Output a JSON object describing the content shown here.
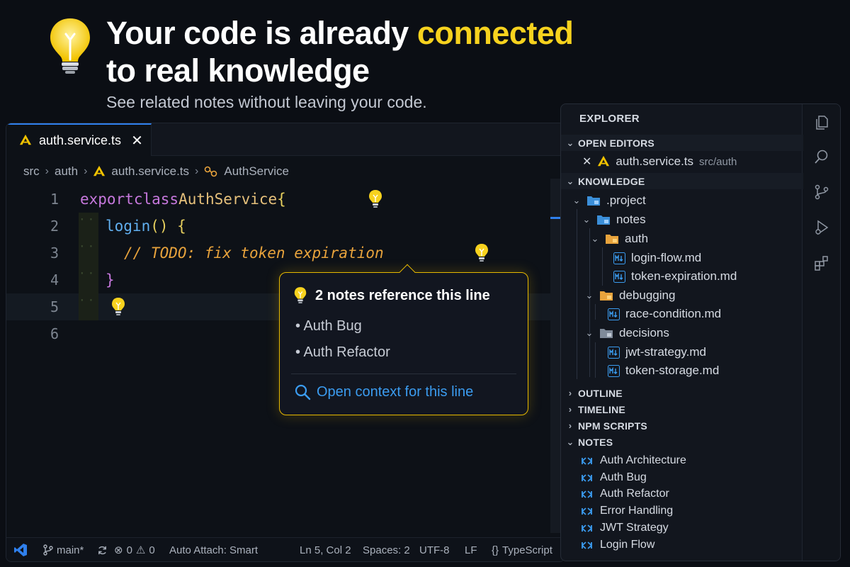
{
  "hero": {
    "title_line1_prefix": "Your code is already ",
    "title_line1_accent": "connected",
    "title_line2": "to real knowledge",
    "subtitle": "See related notes without leaving your code."
  },
  "colors": {
    "accent": "#f7d21e",
    "link": "#3b9cf0",
    "tab_border": "#2f80ed"
  },
  "editor": {
    "tab": {
      "label": "auth.service.ts",
      "close": "✕"
    },
    "breadcrumb": [
      "src",
      "auth",
      "auth.service.ts",
      "AuthService"
    ],
    "lines": {
      "n1": "1",
      "n2": "2",
      "n3": "3",
      "n4": "4",
      "n5": "5",
      "n6": "6",
      "l1_kw1": "export",
      "l1_kw2": "class",
      "l1_cls": "AuthService",
      "l1_brace": "{",
      "l2_fn": "login",
      "l2_punc": "() {",
      "l3_comment": "// TODO: fix token expiration",
      "l4_brace": "}"
    }
  },
  "popup": {
    "title": "2 notes reference this line",
    "items": [
      "• Auth Bug",
      "• Auth Refactor"
    ],
    "link": "Open context for this line"
  },
  "statusbar": {
    "branch": "main*",
    "errors": "0",
    "warnings": "0",
    "auto_attach": "Auto Attach: Smart",
    "position": "Ln 5, Col 2",
    "spaces": "Spaces: 2",
    "encoding": "UTF-8",
    "eol": "LF",
    "language": "TypeScript"
  },
  "sidebar": {
    "explorer": "EXPLORER",
    "open_editors": {
      "title": "OPEN EDITORS",
      "file": "auth.service.ts",
      "path": "src/auth"
    },
    "knowledge": {
      "title": "KNOWLEDGE",
      "root": ".project",
      "notes": "notes",
      "auth": "auth",
      "auth_files": [
        "login-flow.md",
        "token-expiration.md"
      ],
      "debugging": "debugging",
      "debugging_files": [
        "race-condition.md"
      ],
      "decisions": "decisions",
      "decisions_files": [
        "jwt-strategy.md",
        "token-storage.md"
      ]
    },
    "sections": [
      "OUTLINE",
      "TIMELINE",
      "NPM SCRIPTS",
      "NOTES"
    ],
    "notes_list": [
      "Auth Architecture",
      "Auth Bug",
      "Auth Refactor",
      "Error Handling",
      "JWT Strategy",
      "Login Flow"
    ]
  }
}
